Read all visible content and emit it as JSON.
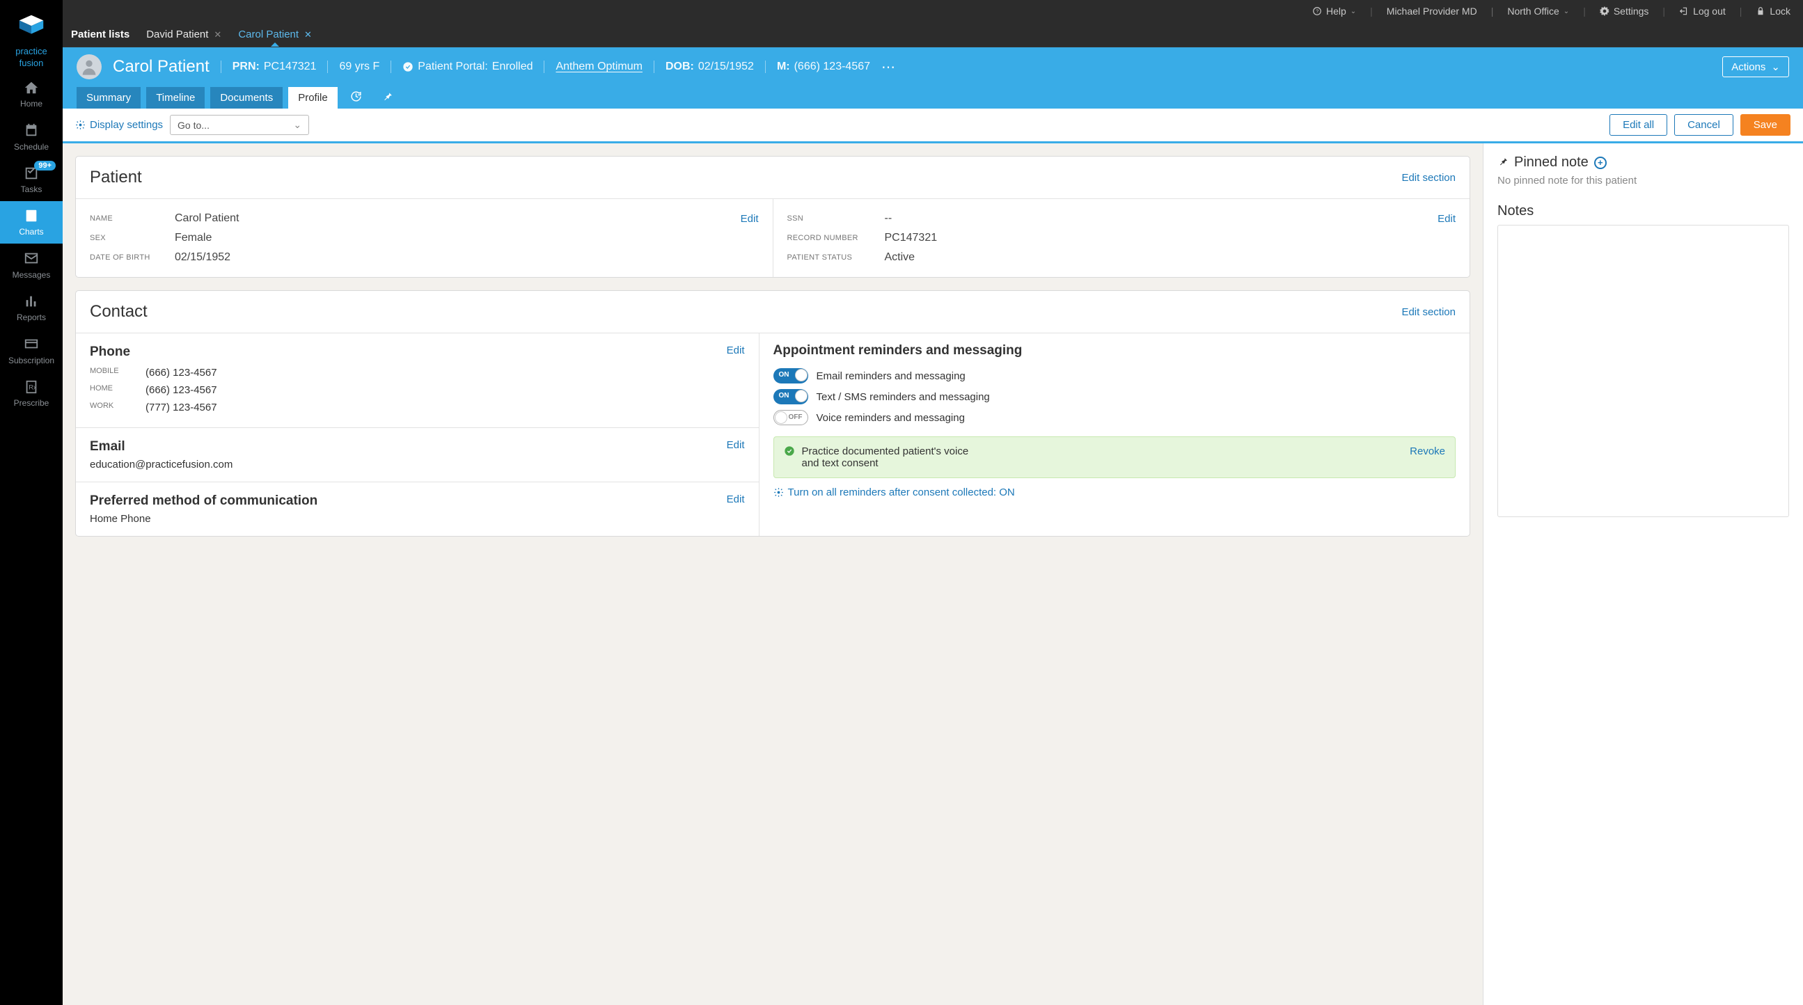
{
  "brand": {
    "line1": "practice",
    "line2": "fusion"
  },
  "nav": {
    "home": "Home",
    "schedule": "Schedule",
    "tasks": "Tasks",
    "tasks_badge": "99+",
    "charts": "Charts",
    "messages": "Messages",
    "reports": "Reports",
    "subscription": "Subscription",
    "prescribe": "Prescribe"
  },
  "topbar": {
    "help": "Help",
    "user": "Michael Provider MD",
    "office": "North Office",
    "settings": "Settings",
    "logout": "Log out",
    "lock": "Lock"
  },
  "tabs": {
    "lists": "Patient lists",
    "david": "David Patient",
    "carol": "Carol Patient"
  },
  "patient": {
    "name": "Carol Patient",
    "prn_label": "PRN:",
    "prn": "PC147321",
    "age_sex": "69 yrs F",
    "portal_label": "Patient Portal:",
    "portal_status": "Enrolled",
    "insurance": "Anthem Optimum",
    "dob_label": "DOB:",
    "dob": "02/15/1952",
    "m_label": "M:",
    "phone": "(666) 123-4567",
    "actions": "Actions"
  },
  "ptabs": {
    "summary": "Summary",
    "timeline": "Timeline",
    "documents": "Documents",
    "profile": "Profile"
  },
  "toolbar": {
    "display": "Display settings",
    "goto": "Go to...",
    "editall": "Edit all",
    "cancel": "Cancel",
    "save": "Save"
  },
  "patient_card": {
    "title": "Patient",
    "edit_section": "Edit section",
    "name_label": "NAME",
    "name_value": "Carol Patient",
    "sex_label": "SEX",
    "sex_value": "Female",
    "dob_label": "DATE OF BIRTH",
    "dob_value": "02/15/1952",
    "ssn_label": "SSN",
    "ssn_value": "--",
    "recnum_label": "RECORD NUMBER",
    "recnum_value": "PC147321",
    "status_label": "PATIENT STATUS",
    "status_value": "Active",
    "edit": "Edit"
  },
  "contact_card": {
    "title": "Contact",
    "edit_section": "Edit section",
    "phone_title": "Phone",
    "mobile_label": "MOBILE",
    "mobile_value": "(666) 123-4567",
    "home_label": "HOME",
    "home_value": "(666) 123-4567",
    "work_label": "WORK",
    "work_value": "(777) 123-4567",
    "email_title": "Email",
    "email_value": "education@practicefusion.com",
    "pref_title": "Preferred method of communication",
    "pref_value": "Home Phone",
    "reminders_title": "Appointment reminders and messaging",
    "toggle_email": "Email reminders and messaging",
    "toggle_text": "Text / SMS reminders and messaging",
    "toggle_voice": "Voice reminders and messaging",
    "on": "ON",
    "off": "OFF",
    "consent_text": "Practice documented patient's voice and text consent",
    "revoke": "Revoke",
    "reminders_link": "Turn on all reminders after consent collected: ON",
    "edit": "Edit"
  },
  "right": {
    "pinned_title": "Pinned note",
    "pinned_empty": "No pinned note for this patient",
    "notes_title": "Notes"
  }
}
